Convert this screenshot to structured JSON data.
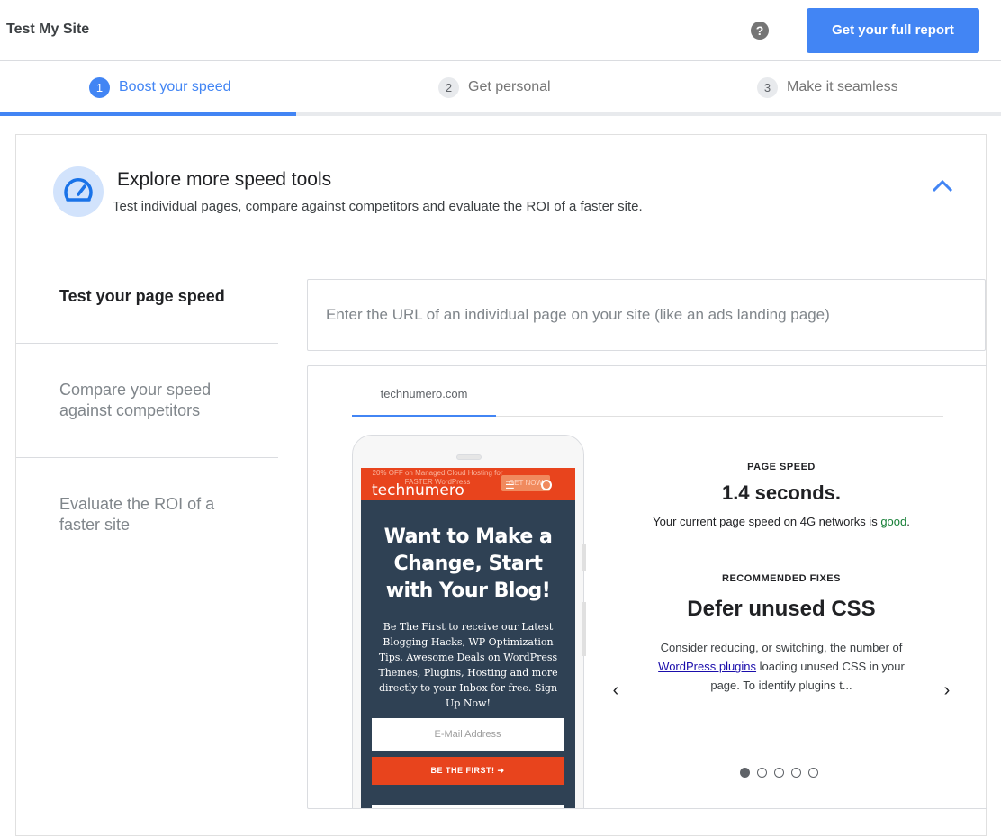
{
  "header": {
    "title": "Test My Site",
    "help_icon": "?",
    "report_button": "Get your full report"
  },
  "steps": [
    {
      "number": "1",
      "label": "Boost your speed",
      "active": true
    },
    {
      "number": "2",
      "label": "Get personal",
      "active": false
    },
    {
      "number": "3",
      "label": "Make it seamless",
      "active": false
    }
  ],
  "card": {
    "title": "Explore more speed tools",
    "subtitle": "Test individual pages, compare against competitors and evaluate the ROI of a faster site."
  },
  "tools": [
    {
      "label": "Test your page speed",
      "active": true
    },
    {
      "label": "Compare your speed against competitors",
      "active": false
    },
    {
      "label": "Evaluate the ROI of a faster site",
      "active": false
    }
  ],
  "url_input": {
    "placeholder": "Enter the URL of an individual page on your site (like an ads landing page)",
    "value": ""
  },
  "result": {
    "site_tab": "technumero.com",
    "preview": {
      "promo": "20% OFF on Managed Cloud Hosting for FASTER WordPress",
      "brand": "technumero",
      "get_now": "GET NOW",
      "heading": "Want to Make a Change, Start with Your Blog!",
      "body": "Be The First to receive our Latest Blogging Hacks, WP Optimization Tips, Awesome Deals on WordPress Themes, Plugins, Hosting and more directly to your Inbox for free. Sign Up Now!",
      "email_placeholder": "E-Mail Address",
      "cta": "BE THE FIRST! ➜"
    },
    "page_speed_label": "PAGE SPEED",
    "page_speed_value": "1.4 seconds.",
    "page_speed_text_before": "Your current page speed on 4G networks is ",
    "page_speed_rating": "good",
    "page_speed_text_after": ".",
    "fixes_label": "RECOMMENDED FIXES",
    "fix_title": "Defer unused CSS",
    "fix_desc_before": "Consider reducing, or switching, the number of ",
    "fix_link": "WordPress plugins",
    "fix_desc_after": " loading unused CSS in your page. To identify plugins t...",
    "prev_arrow": "‹",
    "next_arrow": "›",
    "dots_total": 5,
    "dots_active": 1
  },
  "colors": {
    "accent": "#4285f4",
    "good": "#188038",
    "brand_orange": "#e8441d"
  }
}
